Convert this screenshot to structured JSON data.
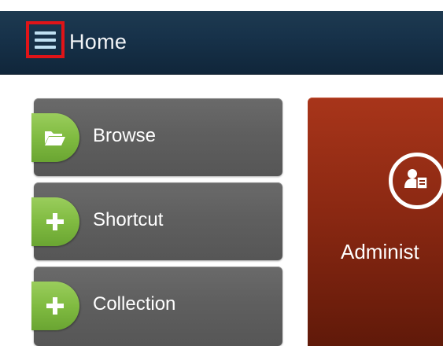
{
  "header": {
    "menu_icon": "hamburger-menu-icon",
    "title": "Home",
    "highlight_color": "#e01418"
  },
  "actions": [
    {
      "label": "Browse",
      "icon": "folder-open-icon"
    },
    {
      "label": "Shortcut",
      "icon": "plus-icon"
    },
    {
      "label": "Collection",
      "icon": "plus-icon"
    }
  ],
  "tile": {
    "label": "Administ",
    "icon": "user-document-icon",
    "color": "#8a2812"
  },
  "colors": {
    "header": "#17324a",
    "panel": "#5f5f5f",
    "accent_green": "#80bb41"
  }
}
